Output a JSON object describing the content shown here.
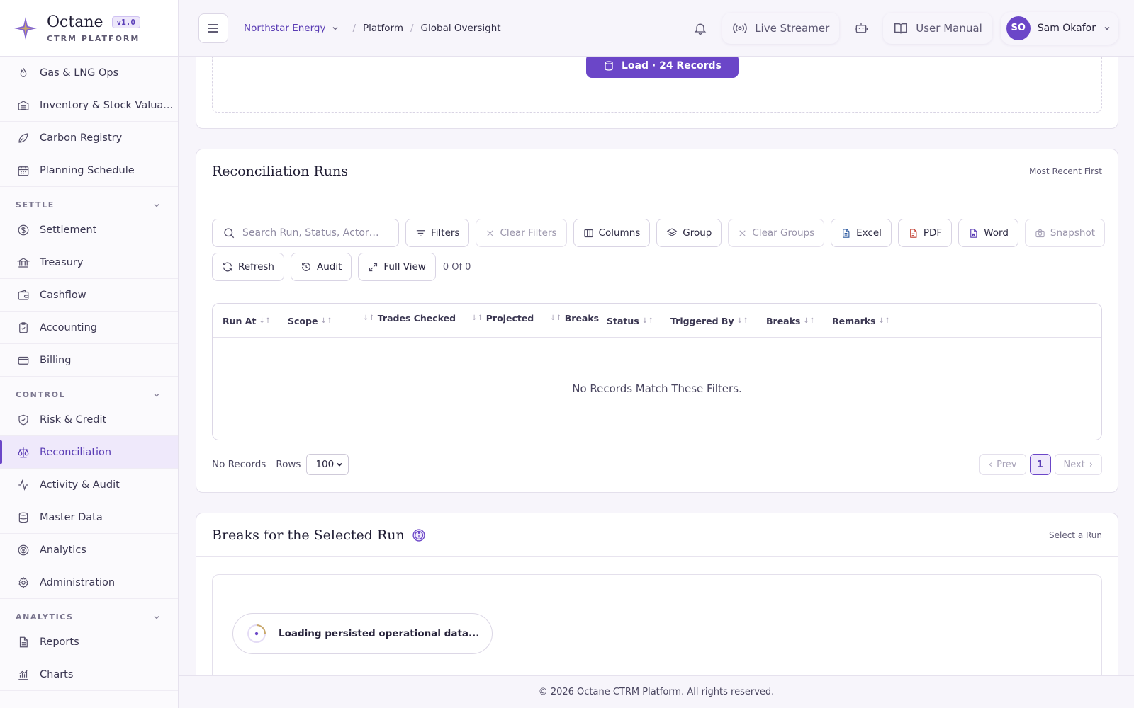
{
  "brand": {
    "name": "Octane",
    "version": "v1.0",
    "subtitle": "CTRM PLATFORM"
  },
  "sidebar": {
    "items_top": [
      {
        "label": "Gas & LNG Ops",
        "icon": "flame-icon"
      },
      {
        "label": "Inventory & Stock Valua...",
        "icon": "warehouse-icon"
      },
      {
        "label": "Carbon Registry",
        "icon": "leaf-icon"
      },
      {
        "label": "Planning Schedule",
        "icon": "calendar-icon"
      }
    ],
    "section_settle": "SETTLE",
    "items_settle": [
      {
        "label": "Settlement",
        "icon": "dollar-circle-icon"
      },
      {
        "label": "Treasury",
        "icon": "bank-icon"
      },
      {
        "label": "Cashflow",
        "icon": "wallet-icon"
      },
      {
        "label": "Accounting",
        "icon": "clipboard-icon"
      },
      {
        "label": "Billing",
        "icon": "card-icon"
      }
    ],
    "section_control": "CONTROL",
    "items_control": [
      {
        "label": "Risk & Credit",
        "icon": "shield-icon"
      },
      {
        "label": "Reconciliation",
        "icon": "scale-icon",
        "active": true
      },
      {
        "label": "Activity & Audit",
        "icon": "activity-icon"
      },
      {
        "label": "Master Data",
        "icon": "database-icon"
      },
      {
        "label": "Analytics",
        "icon": "target-icon"
      },
      {
        "label": "Administration",
        "icon": "gear-icon"
      }
    ],
    "section_analytics": "ANALYTICS",
    "items_analytics": [
      {
        "label": "Reports",
        "icon": "file-icon"
      },
      {
        "label": "Charts",
        "icon": "bar-chart-icon"
      }
    ]
  },
  "topbar": {
    "org": "Northstar Energy",
    "crumb_1": "Platform",
    "crumb_2": "Global Oversight",
    "live_streamer": "Live Streamer",
    "user_manual": "User Manual",
    "user_initials": "SO",
    "user_name": "Sam Okafor"
  },
  "top_card": {
    "load_label": "Load · 24 Records"
  },
  "runs": {
    "title": "Reconciliation Runs",
    "sort_note": "Most Recent First",
    "search_placeholder": "Search Run, Status, Actor…",
    "buttons": {
      "filters": "Filters",
      "clear_filters": "Clear Filters",
      "columns": "Columns",
      "group": "Group",
      "clear_groups": "Clear Groups",
      "excel": "Excel",
      "pdf": "PDF",
      "word": "Word",
      "snapshot": "Snapshot",
      "refresh": "Refresh",
      "audit": "Audit",
      "full_view": "Full View"
    },
    "count": "0 Of 0",
    "columns": [
      "Run At",
      "Scope",
      "Trades Checked",
      "Projected",
      "Breaks",
      "Status",
      "Triggered By",
      "Breaks",
      "Remarks"
    ],
    "empty": "No Records Match These Filters.",
    "no_records": "No Records",
    "rows_label": "Rows",
    "rows_value": "100",
    "prev": "Prev",
    "page": "1",
    "next": "Next"
  },
  "breaks": {
    "title": "Breaks for the Selected Run",
    "note": "Select a Run",
    "loading": "Loading persisted operational data..."
  },
  "footer": "© 2026 Octane CTRM Platform. All rights reserved.",
  "colors": {
    "accent": "#6b46c8",
    "accent_soft": "#efe9fb"
  }
}
